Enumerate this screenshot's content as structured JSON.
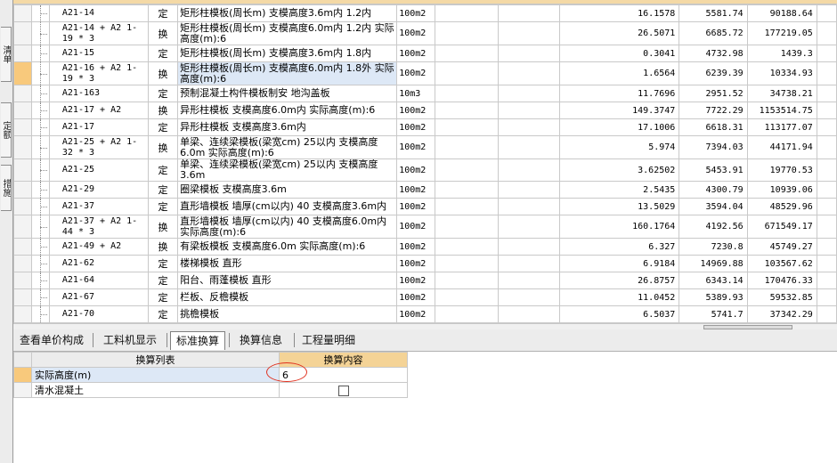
{
  "sidebar": {
    "tabs": [
      {
        "label": "清单"
      },
      {
        "label": "定额"
      },
      {
        "label": "措施"
      }
    ]
  },
  "grid": {
    "rows": [
      {
        "code": "A21-14",
        "type": "定",
        "name": "矩形柱模板(周长m) 支模高度3.6m内 1.2内",
        "unit": "100m2",
        "qty": "16.1578",
        "price": "5581.74",
        "total": "90188.64"
      },
      {
        "code": "A21-14 + A2 1-19 * 3",
        "type": "换",
        "name": "矩形柱模板(周长m) 支模高度6.0m内 1.2内 实际高度(m):6",
        "unit": "100m2",
        "qty": "26.5071",
        "price": "6685.72",
        "total": "177219.05"
      },
      {
        "code": "A21-15",
        "type": "定",
        "name": "矩形柱模板(周长m) 支模高度3.6m内 1.8内",
        "unit": "100m2",
        "qty": "0.3041",
        "price": "4732.98",
        "total": "1439.3"
      },
      {
        "code": "A21-16 + A2 1-19 * 3",
        "type": "换",
        "name": "矩形柱模板(周长m) 支模高度6.0m内 1.8外 实际高度(m):6",
        "unit": "100m2",
        "qty": "1.6564",
        "price": "6239.39",
        "total": "10334.93",
        "selected": true
      },
      {
        "code": "A21-163",
        "type": "定",
        "name": "预制混凝土构件模板制安 地沟盖板",
        "unit": "10m3",
        "qty": "11.7696",
        "price": "2951.52",
        "total": "34738.21"
      },
      {
        "code": "A21-17 + A2",
        "type": "换",
        "name": "异形柱模板 支模高度6.0m内 实际高度(m):6",
        "unit": "100m2",
        "qty": "149.3747",
        "price": "7722.29",
        "total": "1153514.75"
      },
      {
        "code": "A21-17",
        "type": "定",
        "name": "异形柱模板 支模高度3.6m内",
        "unit": "100m2",
        "qty": "17.1006",
        "price": "6618.31",
        "total": "113177.07"
      },
      {
        "code": "A21-25 + A2 1-32 * 3",
        "type": "换",
        "name": "单梁、连续梁模板(梁宽cm) 25以内 支模高度6.0m 实际高度(m):6",
        "unit": "100m2",
        "qty": "5.974",
        "price": "7394.03",
        "total": "44171.94"
      },
      {
        "code": "A21-25",
        "type": "定",
        "name": "单梁、连续梁模板(梁宽cm) 25以内 支模高度3.6m",
        "unit": "100m2",
        "qty": "3.62502",
        "price": "5453.91",
        "total": "19770.53"
      },
      {
        "code": "A21-29",
        "type": "定",
        "name": "圈梁模板 支模高度3.6m",
        "unit": "100m2",
        "qty": "2.5435",
        "price": "4300.79",
        "total": "10939.06"
      },
      {
        "code": "A21-37",
        "type": "定",
        "name": "直形墙模板 墙厚(cm以内) 40 支模高度3.6m内",
        "unit": "100m2",
        "qty": "13.5029",
        "price": "3594.04",
        "total": "48529.96"
      },
      {
        "code": "A21-37 + A2 1-44 * 3",
        "type": "换",
        "name": "直形墙模板 墙厚(cm以内) 40 支模高度6.0m内 实际高度(m):6",
        "unit": "100m2",
        "qty": "160.1764",
        "price": "4192.56",
        "total": "671549.17"
      },
      {
        "code": "A21-49 + A2",
        "type": "换",
        "name": "有梁板模板 支模高度6.0m 实际高度(m):6",
        "unit": "100m2",
        "qty": "6.327",
        "price": "7230.8",
        "total": "45749.27"
      },
      {
        "code": "A21-62",
        "type": "定",
        "name": "楼梯模板 直形",
        "unit": "100m2",
        "qty": "6.9184",
        "price": "14969.88",
        "total": "103567.62"
      },
      {
        "code": "A21-64",
        "type": "定",
        "name": "阳台、雨蓬模板 直形",
        "unit": "100m2",
        "qty": "26.8757",
        "price": "6343.14",
        "total": "170476.33"
      },
      {
        "code": "A21-67",
        "type": "定",
        "name": "栏板、反檐模板",
        "unit": "100m2",
        "qty": "11.0452",
        "price": "5389.93",
        "total": "59532.85"
      },
      {
        "code": "A21-70",
        "type": "定",
        "name": "挑檐模板",
        "unit": "100m2",
        "qty": "6.5037",
        "price": "5741.7",
        "total": "37342.29"
      }
    ]
  },
  "tabs": [
    {
      "label": "查看单价构成"
    },
    {
      "label": "工料机显示"
    },
    {
      "label": "标准换算",
      "active": true
    },
    {
      "label": "换算信息"
    },
    {
      "label": "工程量明细"
    }
  ],
  "panel": {
    "col_list": "换算列表",
    "col_content": "换算内容",
    "rows": [
      {
        "label": "实际高度(m)",
        "value": "6",
        "selected": true
      },
      {
        "label": "清水混凝土",
        "checkbox": true,
        "checked": false
      }
    ]
  },
  "colors": {
    "selected_indicator": "#f8c97c",
    "header_highlight": "#f4d396",
    "annotation_circle": "#e0301e"
  }
}
